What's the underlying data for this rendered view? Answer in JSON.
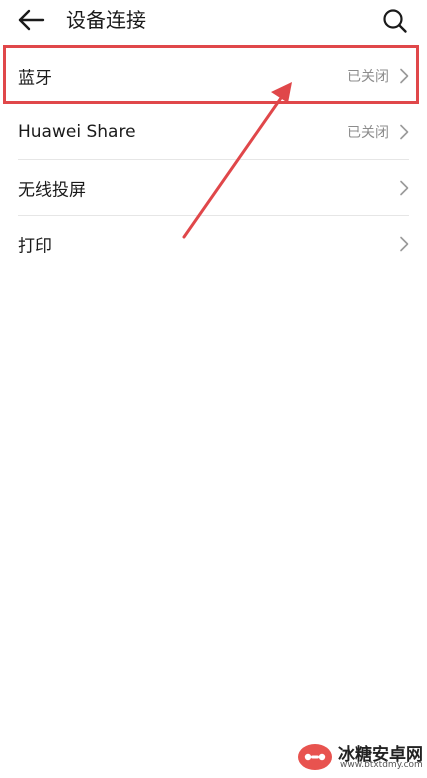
{
  "header": {
    "title": "设备连接",
    "back_icon": "arrow-left-icon",
    "search_icon": "search-icon"
  },
  "items": [
    {
      "label": "蓝牙",
      "status": "已关闭"
    },
    {
      "label": "Huawei Share",
      "status": "已关闭"
    },
    {
      "label": "无线投屏",
      "status": ""
    },
    {
      "label": "打印",
      "status": ""
    }
  ],
  "annotation": {
    "color": "#e0474a"
  },
  "watermark": {
    "name": "冰糖安卓网",
    "url": "www.btxtdmy.com"
  }
}
